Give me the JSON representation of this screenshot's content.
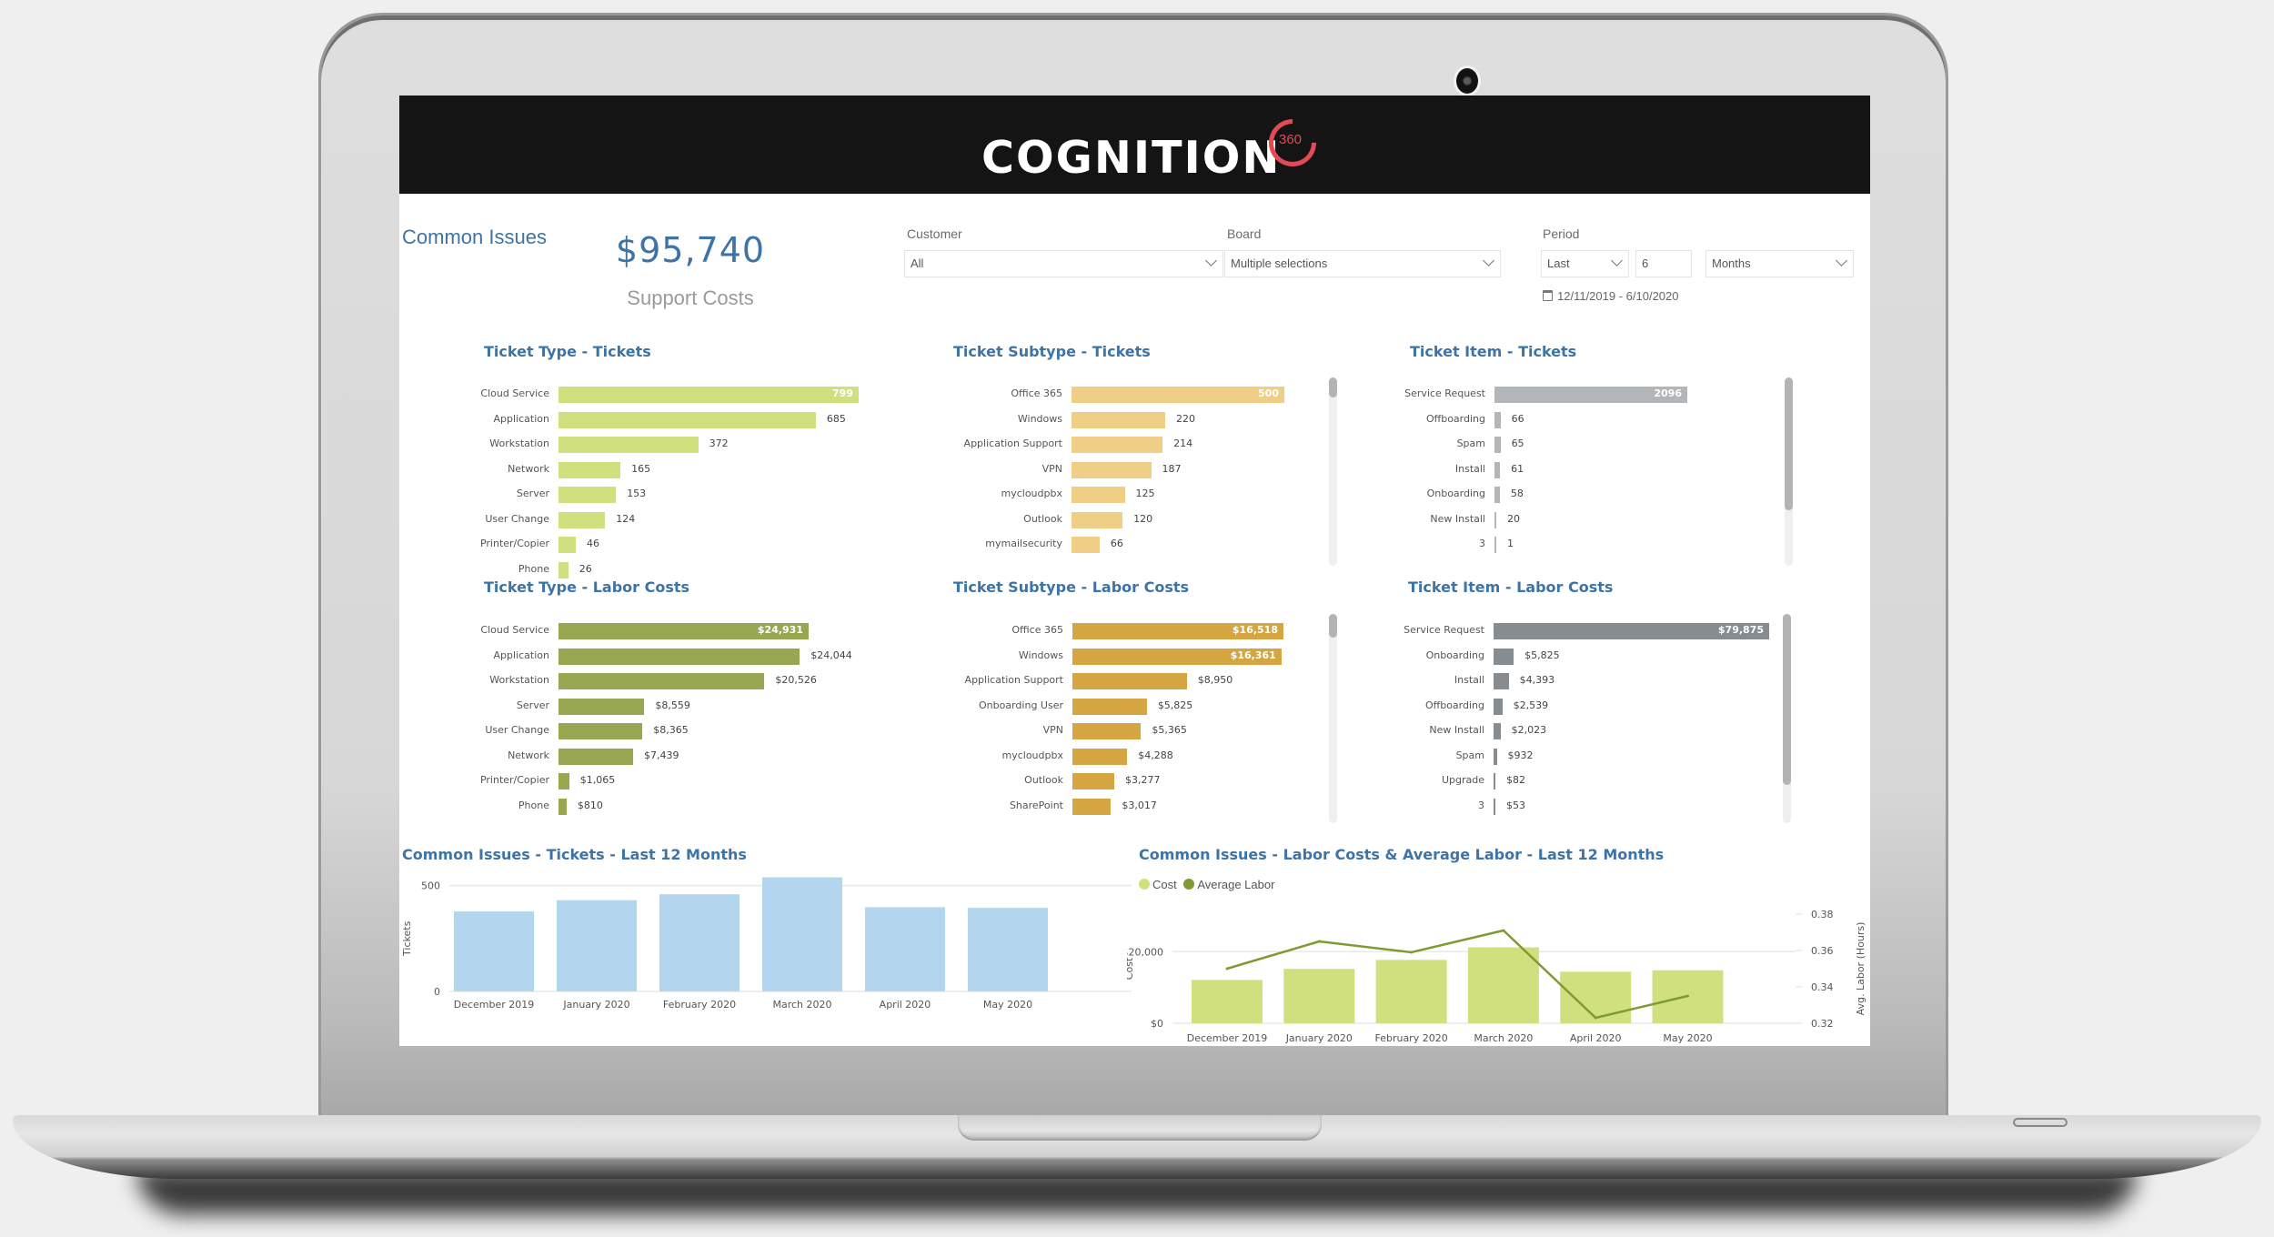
{
  "header": {
    "brand": "COGNITION",
    "brand_badge": "360",
    "brand_accent": "#e24a55"
  },
  "page": {
    "title": "Common Issues"
  },
  "kpi": {
    "value": "$95,740",
    "label": "Support Costs"
  },
  "filters": {
    "customer": {
      "label": "Customer",
      "value": "All"
    },
    "board": {
      "label": "Board",
      "value": "Multiple selections"
    },
    "period": {
      "label": "Period",
      "relative": "Last",
      "count": "6",
      "unit": "Months",
      "date_range": "12/11/2019 - 6/10/2020"
    }
  },
  "colors": {
    "title_blue": "#3e73a6",
    "type_tickets": "#d0e07f",
    "type_costs": "#98a852",
    "subtype_tickets": "#efce85",
    "subtype_costs": "#d4a541",
    "item_tickets": "#b2b6b9",
    "item_costs": "#878c91",
    "monthly_tickets": "#b3d6ee",
    "monthly_cost": "#d0e07f",
    "avg_labor_line": "#7f9a33"
  },
  "chart_data": [
    {
      "id": "type_tickets",
      "type": "bar",
      "orientation": "horizontal",
      "title": "Ticket Type - Tickets",
      "categories": [
        "Cloud Service",
        "Application",
        "Workstation",
        "Network",
        "Server",
        "User Change",
        "Printer/Copier",
        "Phone"
      ],
      "values": [
        799,
        685,
        372,
        165,
        153,
        124,
        46,
        26
      ],
      "labels": [
        "799",
        "685",
        "372",
        "165",
        "153",
        "124",
        "46",
        "26"
      ],
      "scrollable": false
    },
    {
      "id": "subtype_tickets",
      "type": "bar",
      "orientation": "horizontal",
      "title": "Ticket Subtype - Tickets",
      "categories": [
        "Office 365",
        "Windows",
        "Application Support",
        "VPN",
        "mycloudpbx",
        "Outlook",
        "mymailsecurity"
      ],
      "values": [
        500,
        220,
        214,
        187,
        125,
        120,
        66
      ],
      "labels": [
        "500",
        "220",
        "214",
        "187",
        "125",
        "120",
        "66"
      ],
      "scrollable": true,
      "scroll_visible_fraction": 0.1
    },
    {
      "id": "item_tickets",
      "type": "bar",
      "orientation": "horizontal",
      "title": "Ticket Item - Tickets",
      "categories": [
        "Service Request",
        "Offboarding",
        "Spam",
        "Install",
        "Onboarding",
        "New Install",
        "3"
      ],
      "values": [
        2096,
        66,
        65,
        61,
        58,
        20,
        1
      ],
      "labels": [
        "2096",
        "66",
        "65",
        "61",
        "58",
        "20",
        "1"
      ],
      "scrollable": true,
      "scroll_visible_fraction": 0.7
    },
    {
      "id": "type_costs",
      "type": "bar",
      "orientation": "horizontal",
      "title": "Ticket Type - Labor Costs",
      "categories": [
        "Cloud Service",
        "Application",
        "Workstation",
        "Server",
        "User Change",
        "Network",
        "Printer/Copier",
        "Phone"
      ],
      "values": [
        24931,
        24044,
        20526,
        8559,
        8365,
        7439,
        1065,
        810
      ],
      "labels": [
        "$24,931",
        "$24,044",
        "$20,526",
        "$8,559",
        "$8,365",
        "$7,439",
        "$1,065",
        "$810"
      ],
      "scrollable": false
    },
    {
      "id": "subtype_costs",
      "type": "bar",
      "orientation": "horizontal",
      "title": "Ticket Subtype - Labor Costs",
      "categories": [
        "Office 365",
        "Windows",
        "Application Support",
        "Onboarding User",
        "VPN",
        "mycloudpbx",
        "Outlook",
        "SharePoint"
      ],
      "values": [
        16518,
        16361,
        8950,
        5825,
        5365,
        4288,
        3277,
        3017
      ],
      "labels": [
        "$16,518",
        "$16,361",
        "$8,950",
        "$5,825",
        "$5,365",
        "$4,288",
        "$3,277",
        "$3,017"
      ],
      "scrollable": true,
      "scroll_visible_fraction": 0.1
    },
    {
      "id": "item_costs",
      "type": "bar",
      "orientation": "horizontal",
      "title": "Ticket Item - Labor Costs",
      "categories": [
        "Service Request",
        "Onboarding",
        "Install",
        "Offboarding",
        "New Install",
        "Spam",
        "Upgrade",
        "3"
      ],
      "values": [
        79875,
        5825,
        4393,
        2539,
        2023,
        932,
        82,
        53
      ],
      "labels": [
        "$79,875",
        "$5,825",
        "$4,393",
        "$2,539",
        "$2,023",
        "$932",
        "$82",
        "$53"
      ],
      "scrollable": true,
      "scroll_visible_fraction": 0.85
    },
    {
      "id": "monthly_tickets",
      "type": "bar",
      "title": "Common Issues - Tickets - Last 12 Months",
      "categories": [
        "December 2019",
        "January 2020",
        "February 2020",
        "March 2020",
        "April 2020",
        "May 2020"
      ],
      "values": [
        378,
        431,
        459,
        539,
        398,
        395
      ],
      "xlabel": "",
      "ylabel": "Tickets",
      "ylim": [
        0,
        580
      ],
      "yticks": [
        0,
        500
      ],
      "ytick_labels": [
        "0",
        "500"
      ],
      "grid": true
    },
    {
      "id": "monthly_costs",
      "type": "bar+line",
      "title": "Common Issues - Labor Costs & Average Labor - Last 12 Months",
      "categories": [
        "December 2019",
        "January 2020",
        "February 2020",
        "March 2020",
        "April 2020",
        "May 2020"
      ],
      "series": [
        {
          "name": "Cost",
          "type": "bar",
          "axis": "left",
          "values": [
            12100,
            15200,
            17700,
            21200,
            14400,
            14800
          ]
        },
        {
          "name": "Average Labor",
          "type": "line",
          "axis": "right",
          "values": [
            0.35,
            0.365,
            0.359,
            0.371,
            0.323,
            0.335
          ]
        }
      ],
      "ylabel": "Cost",
      "y2label": "Avg. Labor (Hours)",
      "ylim": [
        0,
        31000
      ],
      "yticks": [
        0,
        20000
      ],
      "ytick_labels": [
        "$0",
        "$20,000"
      ],
      "y2lim": [
        0.32,
        0.38
      ],
      "y2ticks": [
        0.32,
        0.34,
        0.36,
        0.38
      ],
      "y2tick_labels": [
        "0.32",
        "0.34",
        "0.36",
        "0.38"
      ],
      "legend": [
        "Cost",
        "Average Labor"
      ],
      "legend_position": "top-left",
      "grid": true
    }
  ]
}
